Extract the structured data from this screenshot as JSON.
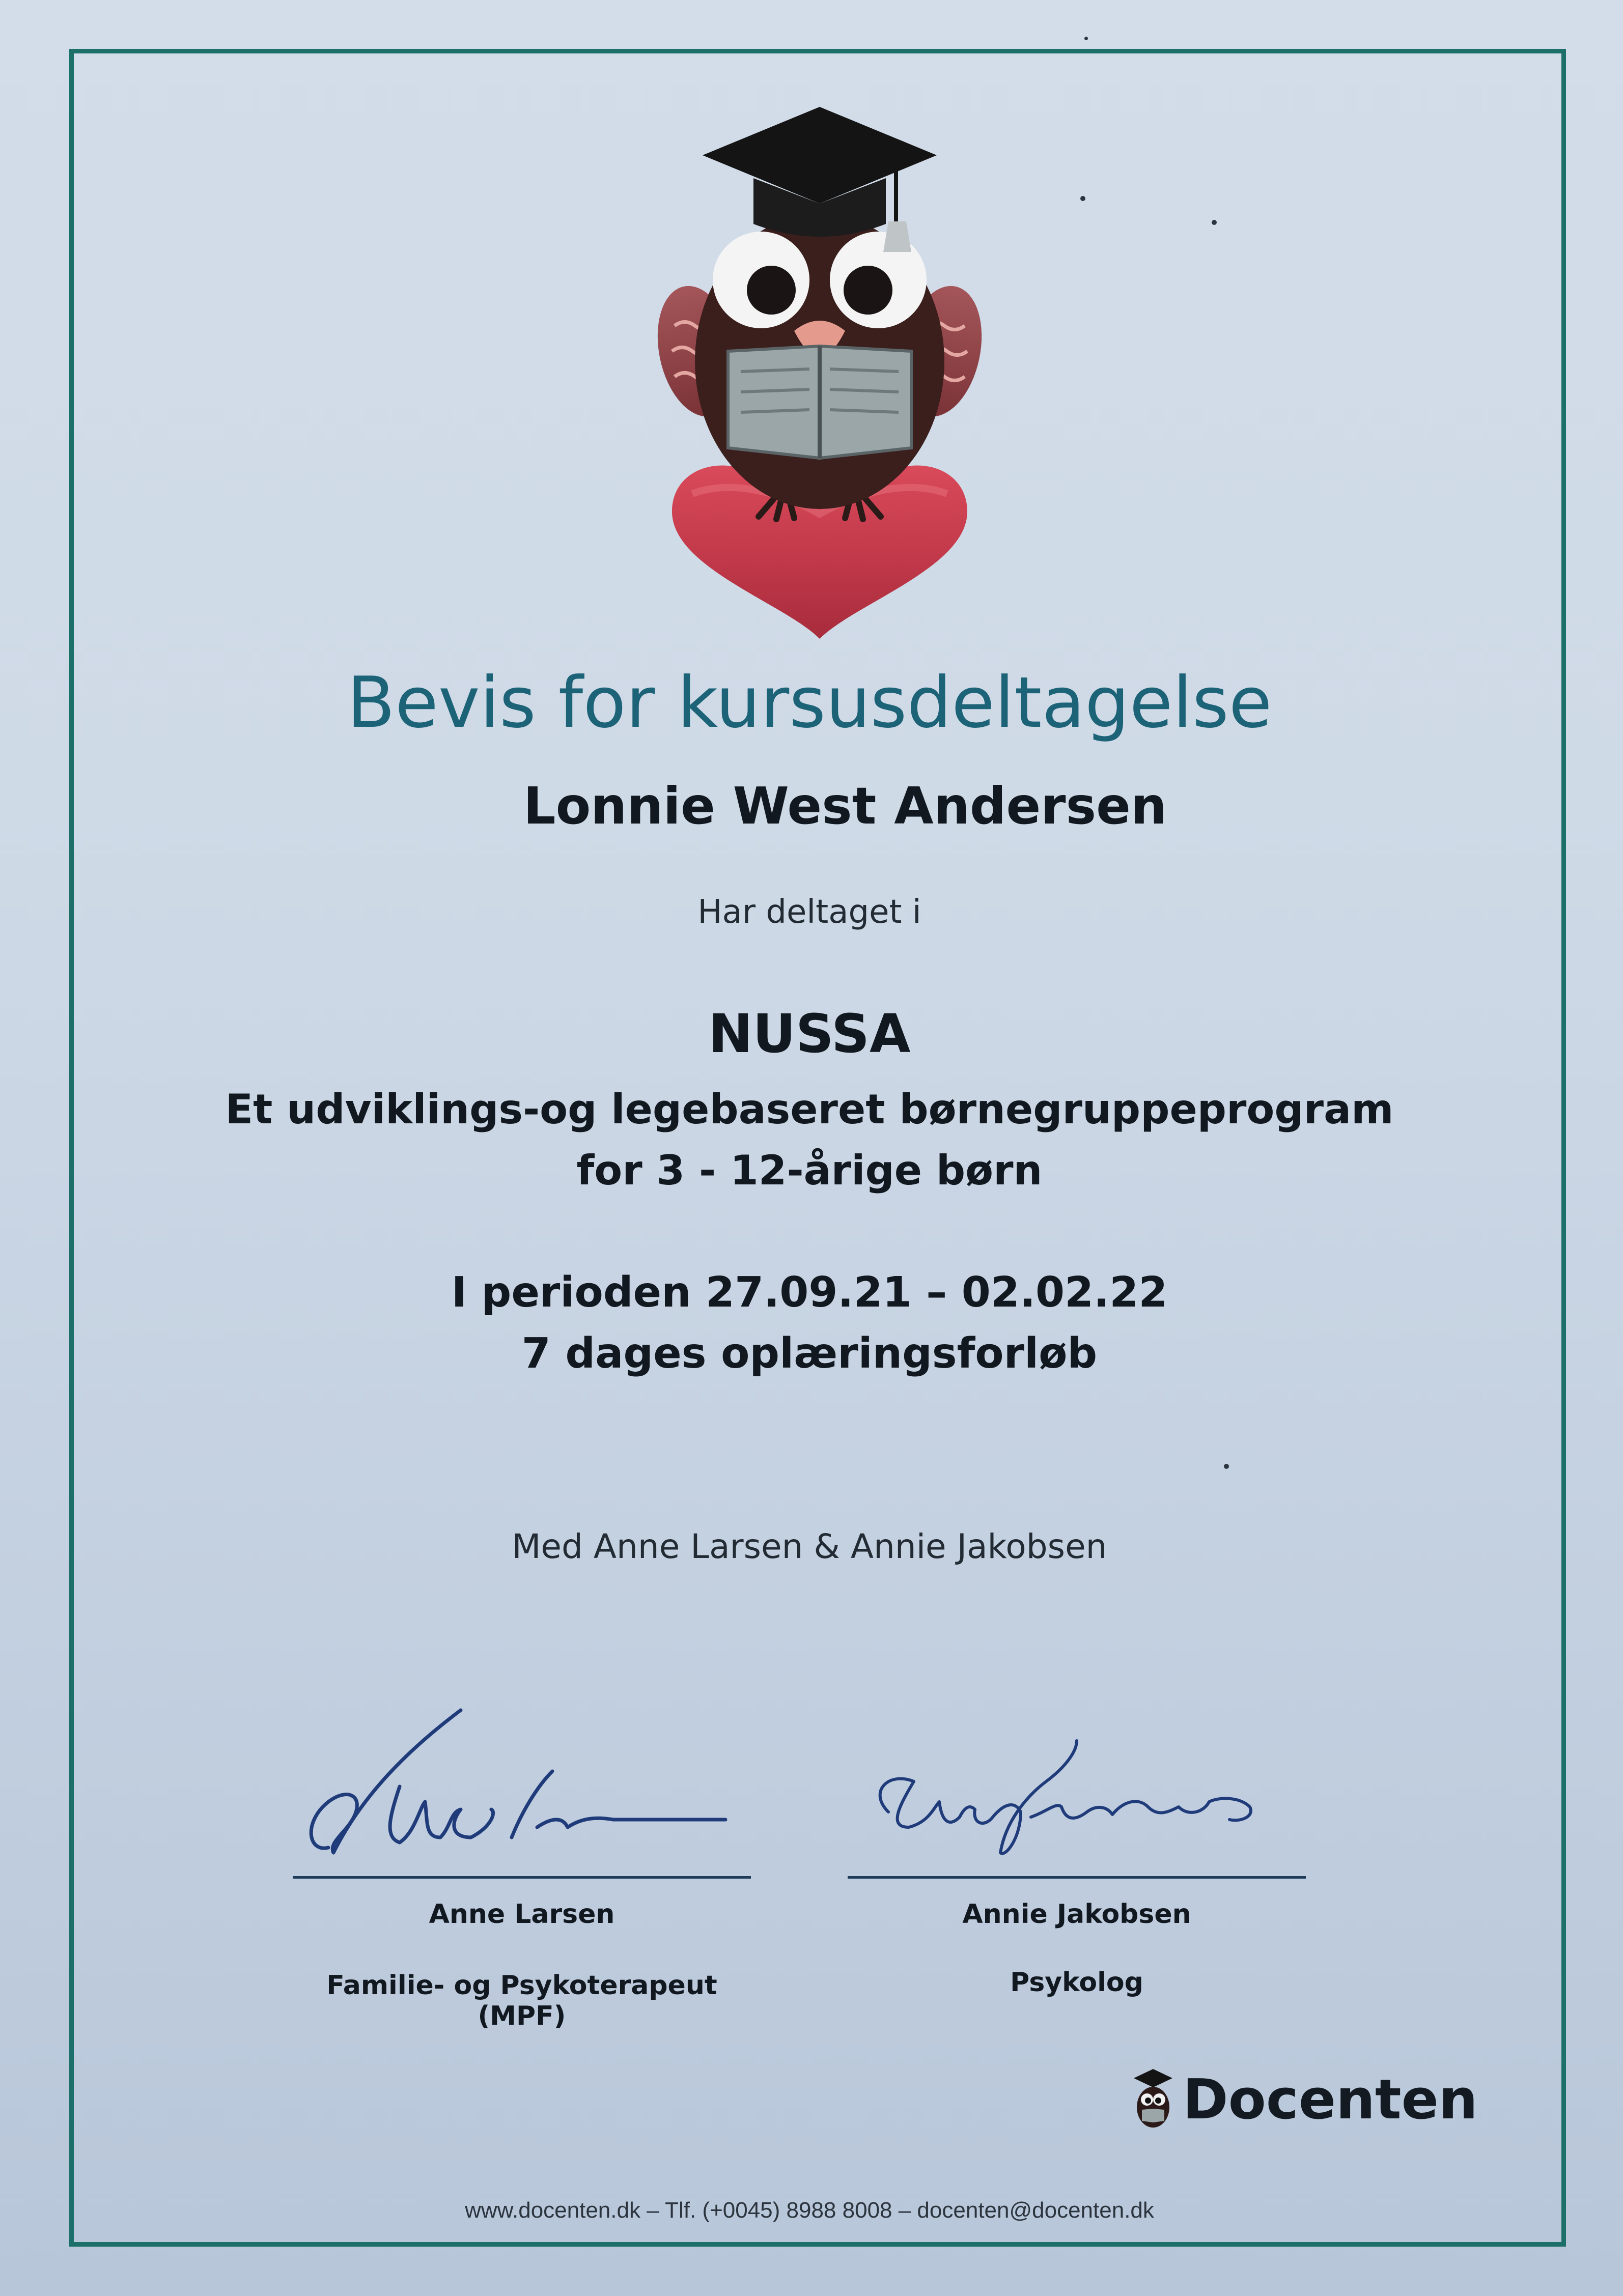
{
  "certificate": {
    "title": "Bevis for kursusdeltagelse",
    "participant_name": "Lonnie West Andersen",
    "participated_text": "Har deltaget i",
    "program_name": "NUSSA",
    "program_subtitle_line1": "Et udviklings-og legebaseret børnegruppeprogram",
    "program_subtitle_line2": "for 3 - 12-årige børn",
    "period": "I perioden 27.09.21 – 02.02.22",
    "duration": "7 dages oplæringsforløb",
    "instructors": "Med Anne Larsen & Annie Jakobsen"
  },
  "signatures": [
    {
      "name": "Anne Larsen",
      "role": "Familie- og Psykoterapeut (MPF)"
    },
    {
      "name": "Annie Jakobsen",
      "role": "Psykolog"
    }
  ],
  "brand": {
    "logo_text": "Docenten",
    "footer": "www.docenten.dk – Tlf. (+0045) 8988 8008 – docenten@docenten.dk"
  },
  "colors": {
    "frame": "#1d6f6a",
    "title": "#1d6378",
    "heart": "#c9384a",
    "paper": "#cfdae7"
  },
  "icons": {
    "illustration": "owl-graduate-icon",
    "logo": "owl-logo-icon"
  }
}
